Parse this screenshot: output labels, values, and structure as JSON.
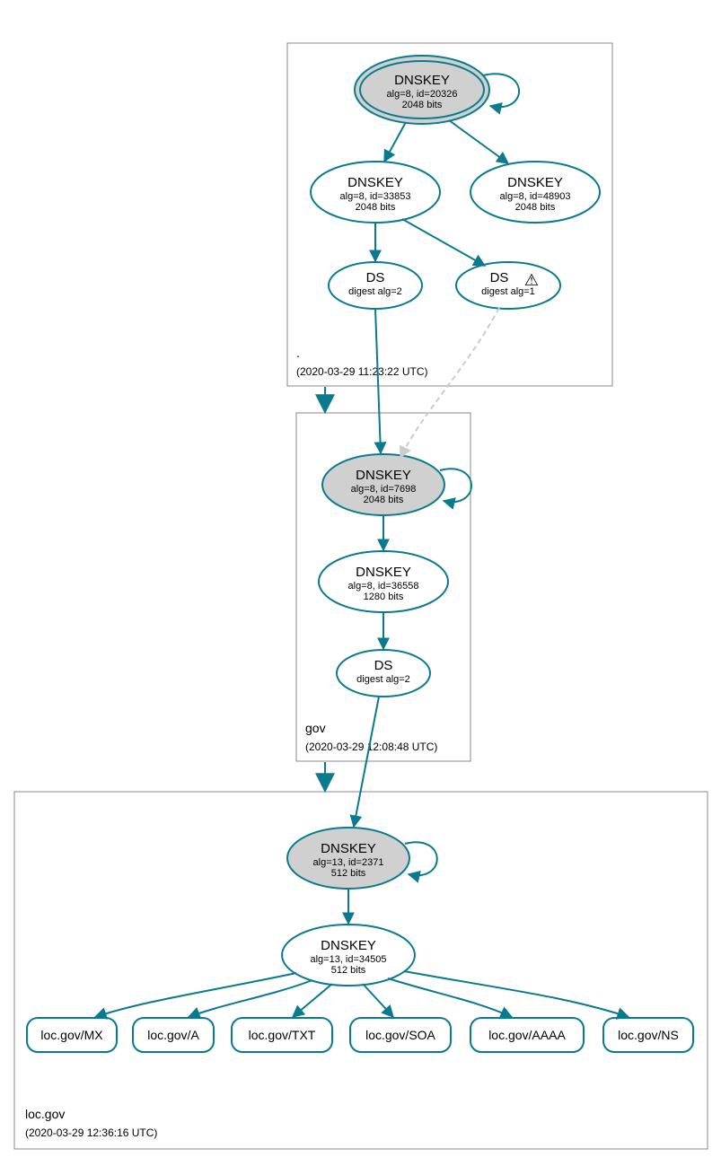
{
  "zones": {
    "root": {
      "label": ".",
      "timestamp": "(2020-03-29 11:23:22 UTC)"
    },
    "gov": {
      "label": "gov",
      "timestamp": "(2020-03-29 12:08:48 UTC)"
    },
    "loc": {
      "label": "loc.gov",
      "timestamp": "(2020-03-29 12:36:16 UTC)"
    }
  },
  "nodes": {
    "root_ksk": {
      "title": "DNSKEY",
      "line1": "alg=8, id=20326",
      "line2": "2048 bits"
    },
    "root_zsk1": {
      "title": "DNSKEY",
      "line1": "alg=8, id=33853",
      "line2": "2048 bits"
    },
    "root_zsk2": {
      "title": "DNSKEY",
      "line1": "alg=8, id=48903",
      "line2": "2048 bits"
    },
    "root_ds1": {
      "title": "DS",
      "line1": "digest alg=2",
      "line2": ""
    },
    "root_ds2": {
      "title": "DS",
      "line1": "digest alg=1",
      "line2": ""
    },
    "root_ds2_warn": "⚠",
    "gov_ksk": {
      "title": "DNSKEY",
      "line1": "alg=8, id=7698",
      "line2": "2048 bits"
    },
    "gov_zsk": {
      "title": "DNSKEY",
      "line1": "alg=8, id=36558",
      "line2": "1280 bits"
    },
    "gov_ds": {
      "title": "DS",
      "line1": "digest alg=2",
      "line2": ""
    },
    "loc_ksk": {
      "title": "DNSKEY",
      "line1": "alg=13, id=2371",
      "line2": "512 bits"
    },
    "loc_zsk": {
      "title": "DNSKEY",
      "line1": "alg=13, id=34505",
      "line2": "512 bits"
    }
  },
  "records": {
    "mx": "loc.gov/MX",
    "a": "loc.gov/A",
    "txt": "loc.gov/TXT",
    "soa": "loc.gov/SOA",
    "aaaa": "loc.gov/AAAA",
    "ns": "loc.gov/NS"
  }
}
